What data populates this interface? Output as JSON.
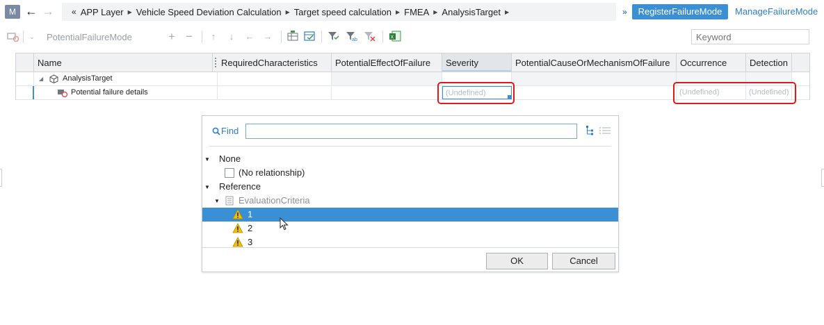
{
  "app": {
    "badge": "M"
  },
  "breadcrumb": {
    "lead": "«",
    "items": [
      "APP Layer",
      "Vehicle Speed Deviation Calculation",
      "Target speed calculation",
      "FMEA",
      "AnalysisTarget"
    ],
    "more": "»"
  },
  "header_actions": {
    "register": "RegisterFailureMode",
    "manage": "ManageFailureMode"
  },
  "toolbar": {
    "title": "PotentialFailureMode",
    "keyword_placeholder": "Keyword"
  },
  "grid": {
    "columns": [
      "Name",
      "RequiredCharacteristics",
      "PotentialEffectOfFailure",
      "Severity",
      "PotentialCauseOrMechanismOfFailure",
      "Occurrence",
      "Detection"
    ],
    "rows": [
      {
        "name": "AnalysisTarget",
        "type": "parent"
      },
      {
        "name": "Potential failure details",
        "type": "child",
        "severity": "(Undefined)",
        "occurrence": "(Undefined)",
        "detection": "(Undefined)"
      }
    ]
  },
  "dialog": {
    "find_label": "Find",
    "find_value": "",
    "tree": {
      "groups": [
        {
          "label": "None",
          "children": [
            {
              "label": "(No relationship)"
            }
          ]
        },
        {
          "label": "Reference",
          "children": [
            {
              "label": "EvaluationCriteria",
              "children": [
                {
                  "label": "1",
                  "selected": true
                },
                {
                  "label": "2"
                },
                {
                  "label": "3"
                }
              ]
            }
          ]
        }
      ]
    },
    "ok": "OK",
    "cancel": "Cancel"
  },
  "colors": {
    "accent": "#3b8fd4",
    "link": "#2c7fc6",
    "highlight": "#e01818",
    "warning": "#f2c200"
  }
}
